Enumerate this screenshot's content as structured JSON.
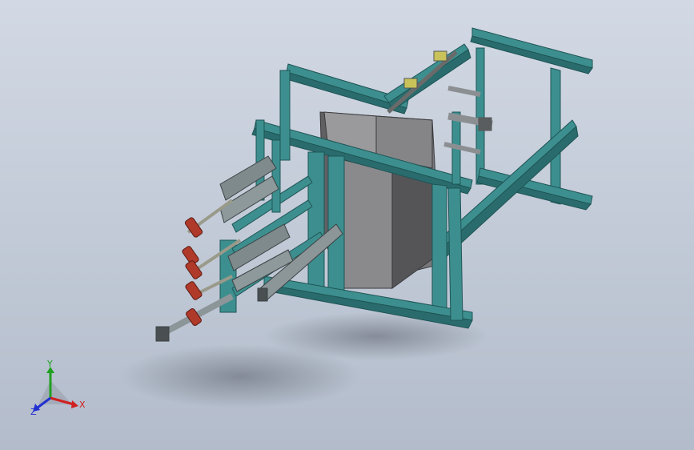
{
  "viewport": {
    "background_top": "#d2d9e4",
    "background_bottom": "#b3bccb"
  },
  "model": {
    "frame_color": "#3d8f8f",
    "frame_dark": "#2a6c6d",
    "body_color": "#6e6e70",
    "actuator_color": "#7f8a8c",
    "cap_color": "#b03a2a"
  },
  "triad": {
    "x_label": "X",
    "y_label": "Y",
    "z_label": "Z",
    "x_color": "#d02020",
    "y_color": "#20a020",
    "z_color": "#2030d0"
  }
}
